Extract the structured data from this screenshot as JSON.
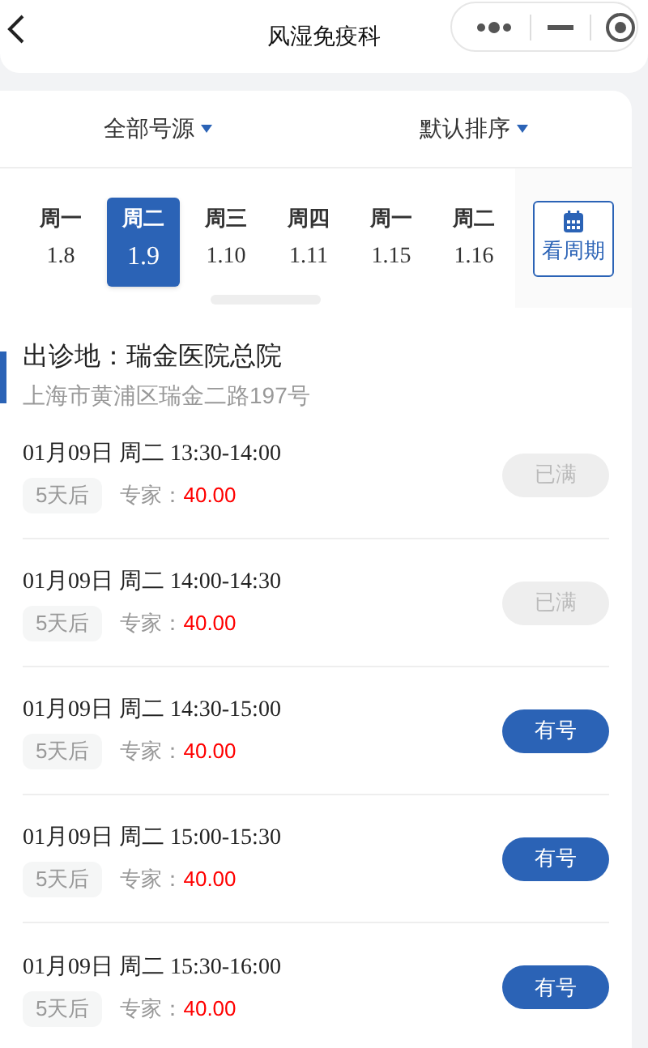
{
  "header": {
    "title": "风湿免疫科"
  },
  "filters": [
    {
      "label": "全部号源"
    },
    {
      "label": "默认排序"
    }
  ],
  "dates": [
    {
      "weekday": "周一",
      "date": "1.8",
      "selected": false
    },
    {
      "weekday": "周二",
      "date": "1.9",
      "selected": true
    },
    {
      "weekday": "周三",
      "date": "1.10",
      "selected": false
    },
    {
      "weekday": "周四",
      "date": "1.11",
      "selected": false
    },
    {
      "weekday": "周一",
      "date": "1.15",
      "selected": false
    },
    {
      "weekday": "周二",
      "date": "1.16",
      "selected": false
    }
  ],
  "calendar_button": {
    "label": "看周期"
  },
  "location": {
    "title": "出诊地：瑞金医院总院",
    "address": "上海市黄浦区瑞金二路197号"
  },
  "slots": [
    {
      "time": "01月09日 周二 13:30-14:00",
      "tag": "5天后",
      "fee_label": "专家：",
      "fee": "40.00",
      "button": "已满",
      "available": false
    },
    {
      "time": "01月09日 周二 14:00-14:30",
      "tag": "5天后",
      "fee_label": "专家：",
      "fee": "40.00",
      "button": "已满",
      "available": false
    },
    {
      "time": "01月09日 周二 14:30-15:00",
      "tag": "5天后",
      "fee_label": "专家：",
      "fee": "40.00",
      "button": "有号",
      "available": true
    },
    {
      "time": "01月09日 周二 15:00-15:30",
      "tag": "5天后",
      "fee_label": "专家：",
      "fee": "40.00",
      "button": "有号",
      "available": true
    },
    {
      "time": "01月09日 周二 15:30-16:00",
      "tag": "5天后",
      "fee_label": "专家：",
      "fee": "40.00",
      "button": "有号",
      "available": true
    }
  ]
}
